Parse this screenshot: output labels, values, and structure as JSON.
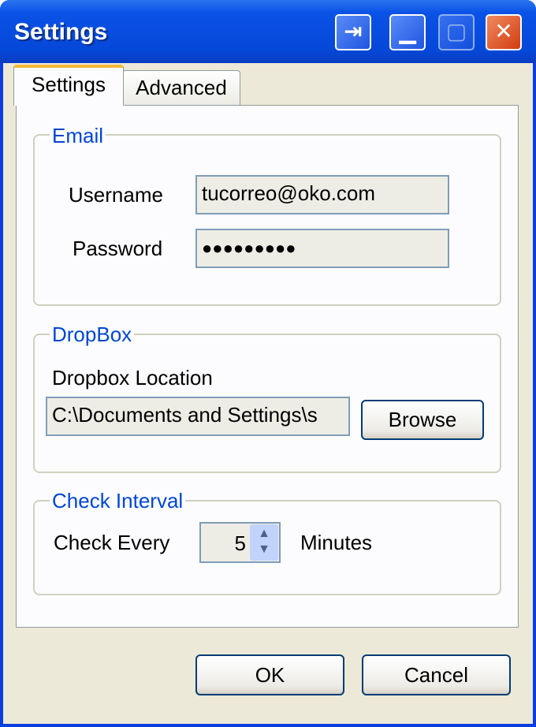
{
  "window": {
    "title": "Settings",
    "buttons": [
      "help-icon",
      "minimize-icon",
      "maximize-icon",
      "close-icon"
    ]
  },
  "tabs": [
    {
      "label": "Settings",
      "active": true
    },
    {
      "label": "Advanced",
      "active": false
    }
  ],
  "email": {
    "legend": "Email",
    "username_label": "Username",
    "username_value": "tucorreo@oko.com",
    "password_label": "Password",
    "password_value": "●●●●●●●●●"
  },
  "dropbox": {
    "legend": "DropBox",
    "location_label": "Dropbox Location",
    "location_value": "C:\\Documents and Settings\\s",
    "browse_label": "Browse"
  },
  "interval": {
    "legend": "Check Interval",
    "check_label": "Check Every",
    "value": "5",
    "unit_label": "Minutes"
  },
  "footer": {
    "ok_label": "OK",
    "cancel_label": "Cancel"
  },
  "colors": {
    "titlebar": "#0548d8",
    "legend": "#0046d5",
    "close": "#d23c10"
  }
}
